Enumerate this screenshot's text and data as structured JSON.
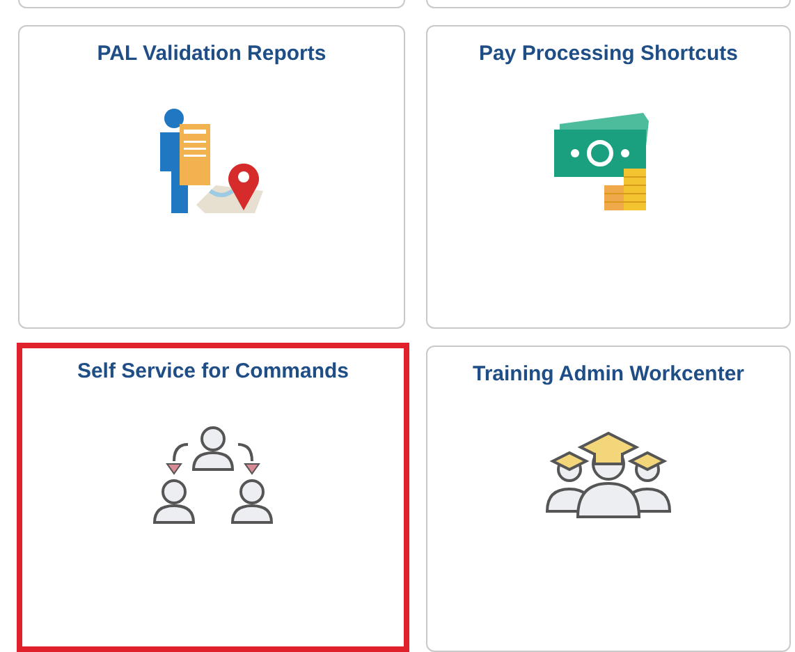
{
  "tiles": [
    {
      "title": "PAL Validation Reports",
      "selected": false
    },
    {
      "title": "Pay Processing Shortcuts",
      "selected": false
    },
    {
      "title": "Self Service for Commands",
      "selected": true
    },
    {
      "title": "Training Admin Workcenter",
      "selected": false
    }
  ]
}
